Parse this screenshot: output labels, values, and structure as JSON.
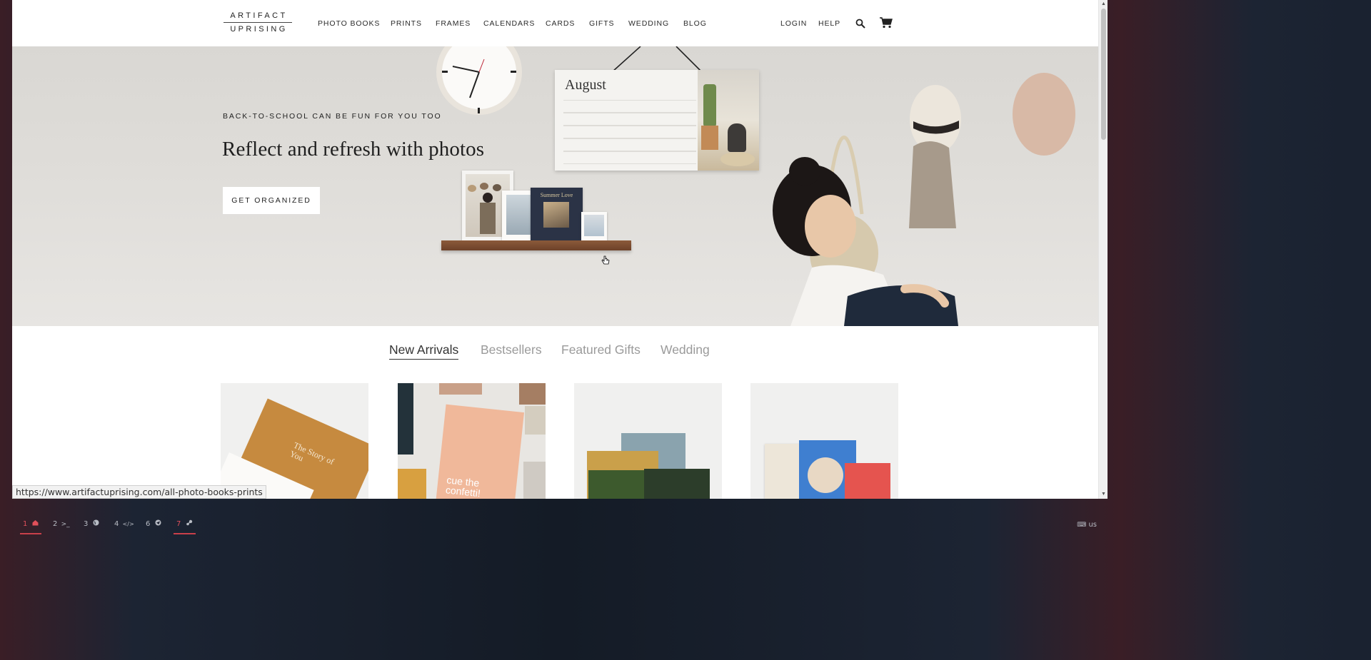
{
  "header": {
    "logo_line1": "ARTIFACT",
    "logo_line2": "UPRISING",
    "nav": [
      "PHOTO BOOKS",
      "PRINTS",
      "FRAMES",
      "CALENDARS",
      "CARDS",
      "GIFTS",
      "WEDDING",
      "BLOG"
    ],
    "login": "LOGIN",
    "help": "HELP",
    "search_icon": "search-icon",
    "cart_icon": "cart-icon"
  },
  "hero": {
    "kicker": "BACK-TO-SCHOOL CAN BE FUN FOR YOU TOO",
    "title": "Reflect and refresh with photos",
    "cta": "GET ORGANIZED",
    "calendar_month": "August",
    "frame_caption": "Summer Love"
  },
  "tabs": {
    "items": [
      "New Arrivals",
      "Bestsellers",
      "Featured Gifts",
      "Wedding"
    ],
    "active": "New Arrivals"
  },
  "products": {
    "card1_text": "The Story of You",
    "card2_text": "cue the confetti!"
  },
  "status_bar": {
    "url": "https://www.artifactuprising.com/all-photo-books-prints"
  },
  "taskbar": {
    "workspaces": [
      {
        "num": "1",
        "icon": "home-icon"
      },
      {
        "num": "2",
        "icon": "terminal-icon"
      },
      {
        "num": "3",
        "icon": "globe-icon"
      },
      {
        "num": "4",
        "icon": "code-icon"
      },
      {
        "num": "6",
        "icon": "telegram-icon"
      },
      {
        "num": "7",
        "icon": "steam-icon"
      }
    ],
    "tray_layout": "us",
    "tray_icon": "keyboard-icon"
  },
  "colors": {
    "accent_red": "#e0505a",
    "hero_bg": "#dfddd9",
    "text_dark": "#222222"
  }
}
